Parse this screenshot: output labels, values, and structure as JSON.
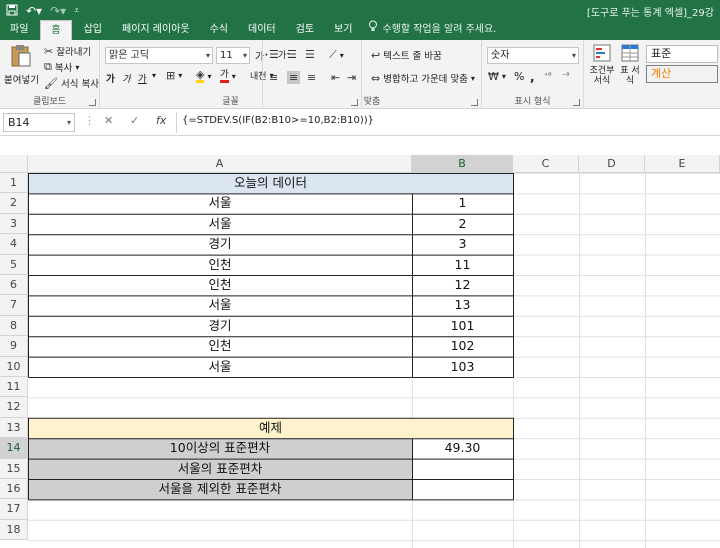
{
  "titlebar": {
    "doc_title": "[도구로 푸는 통계 엑셀]_29강",
    "qat_icons": [
      "save-icon",
      "undo-icon",
      "redo-icon",
      "customize-qat-icon"
    ]
  },
  "tabs": [
    {
      "label": "파일"
    },
    {
      "label": "홈"
    },
    {
      "label": "삽입"
    },
    {
      "label": "페이지 레이아웃"
    },
    {
      "label": "수식"
    },
    {
      "label": "데이터"
    },
    {
      "label": "검토"
    },
    {
      "label": "보기"
    }
  ],
  "tell_me": "수행할 작업을 알려 주세요.",
  "ribbon": {
    "clipboard": {
      "paste": "붙여넣기",
      "cut": "잘라내기",
      "copy": "복사",
      "format_painter": "서식 복사",
      "label": "클립보드"
    },
    "font": {
      "font_name": "맑은 고딕",
      "font_size": "11",
      "bold": "가",
      "italic": "가",
      "underline": "가",
      "font_color_letter": "가",
      "phonetic": "내천",
      "label": "글꼴"
    },
    "alignment": {
      "wrap_text": "텍스트 줄 바꿈",
      "merge_center": "병합하고 가운데 맞춤",
      "label": "맞춤"
    },
    "number": {
      "format": "숫자",
      "percent": "%",
      "comma": ",",
      "label": "표시 형식"
    },
    "styles": {
      "conditional_formatting": "조건부 서식",
      "format_as_table": "표 서식",
      "style_normal": "표준",
      "style_calc": "계산"
    }
  },
  "formula_bar": {
    "name_box": "B14",
    "cancel": "✕",
    "enter": "✓",
    "fx": "fx",
    "formula": "{=STDEV.S(IF(B2:B10>=10,B2:B10))}"
  },
  "columns": [
    "A",
    "B",
    "C",
    "D",
    "E"
  ],
  "rows": [
    "1",
    "2",
    "3",
    "4",
    "5",
    "6",
    "7",
    "8",
    "9",
    "10",
    "11",
    "12",
    "13",
    "14",
    "15",
    "16",
    "17",
    "18"
  ],
  "sheet": {
    "header_title": "오늘의 데이터",
    "data": [
      {
        "city": "서울",
        "value": "1"
      },
      {
        "city": "서울",
        "value": "2"
      },
      {
        "city": "경기",
        "value": "3"
      },
      {
        "city": "인천",
        "value": "11"
      },
      {
        "city": "인천",
        "value": "12"
      },
      {
        "city": "서울",
        "value": "13"
      },
      {
        "city": "경기",
        "value": "101"
      },
      {
        "city": "인천",
        "value": "102"
      },
      {
        "city": "서울",
        "value": "103"
      }
    ],
    "example_title": "예제",
    "examples": [
      {
        "label": "10이상의 표준편차",
        "value": "49.30"
      },
      {
        "label": "서울의 표준편차",
        "value": ""
      },
      {
        "label": "서울을 제외한 표준편차",
        "value": ""
      }
    ]
  },
  "colors": {
    "excel_green": "#217346",
    "header_blue": "#dce6f1",
    "example_yellow": "#fff2cc",
    "label_gray": "#d0cece"
  }
}
